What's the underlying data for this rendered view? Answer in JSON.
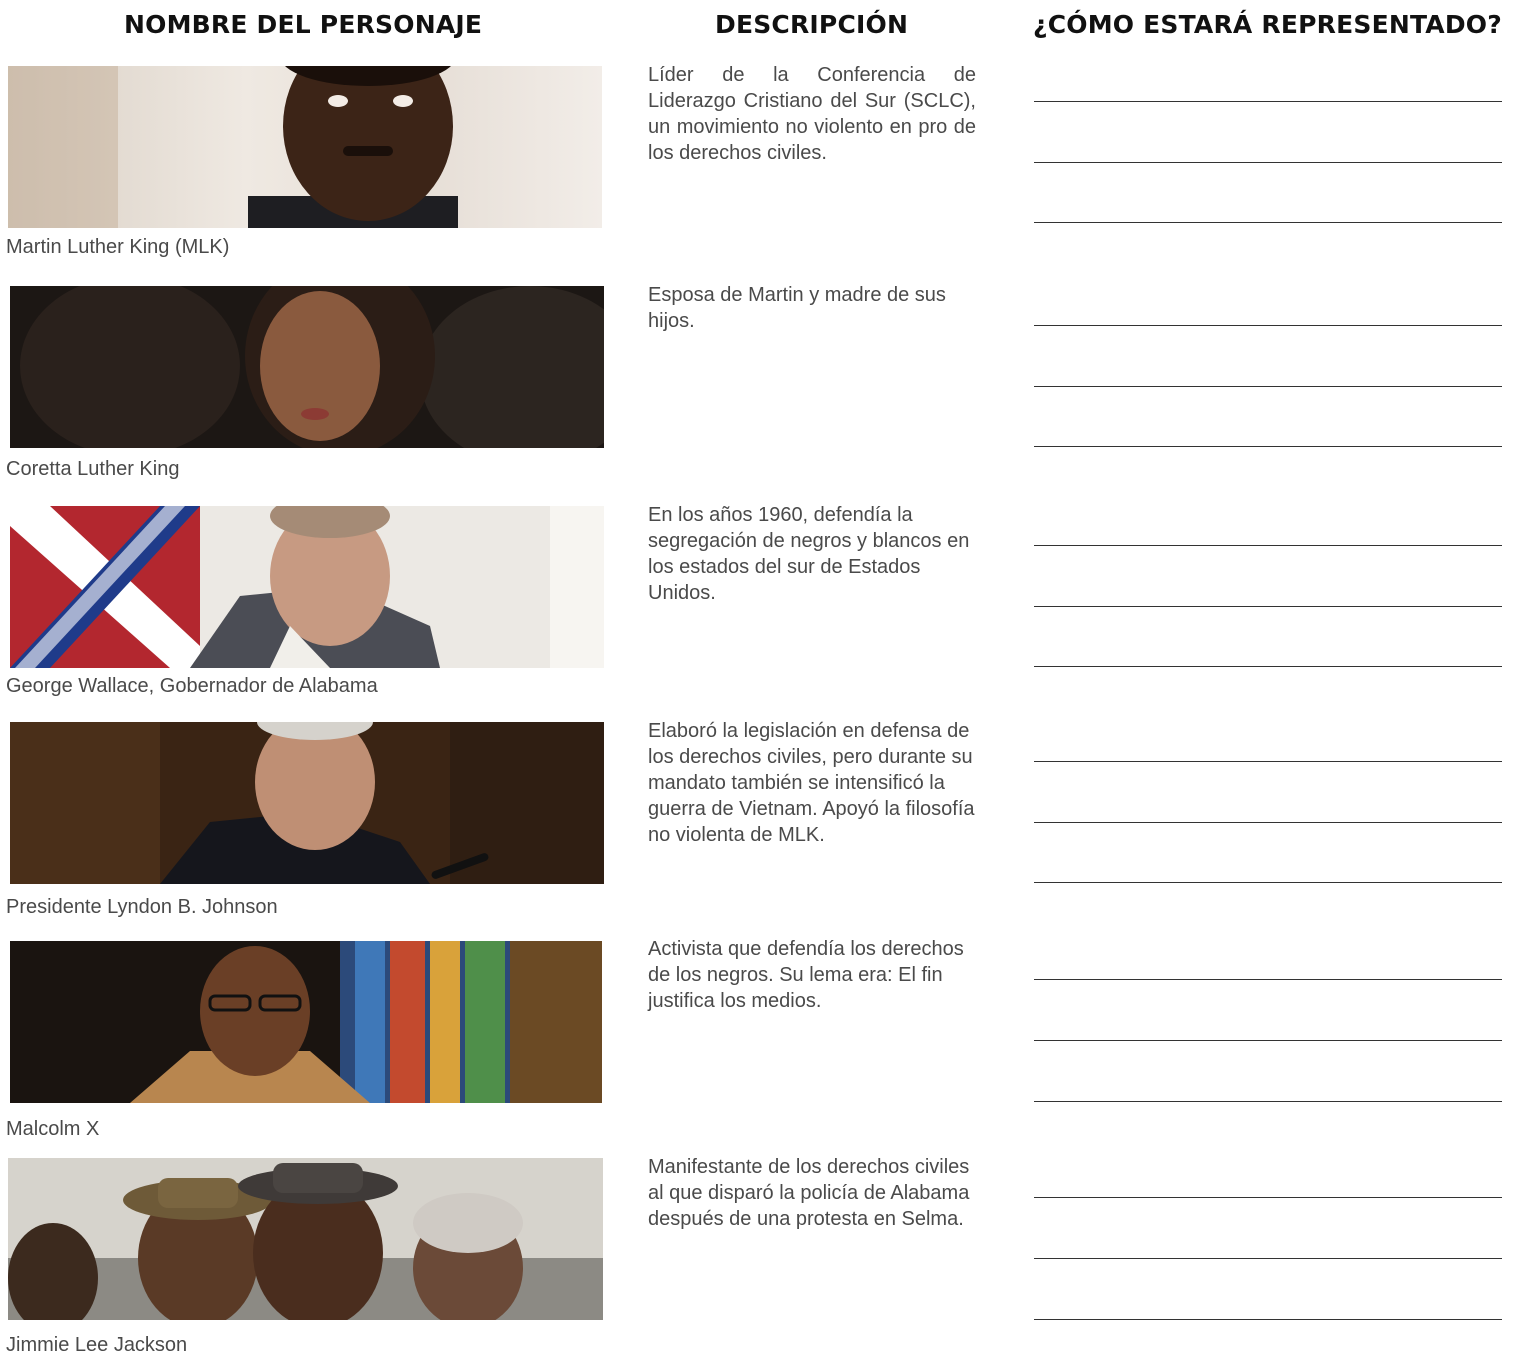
{
  "headers": {
    "name": "NOMBRE DEL PERSONAJE",
    "description": "DESCRIPCIÓN",
    "representation": "¿CÓMO ESTARÁ REPRESENTADO?"
  },
  "characters": [
    {
      "name": "Martin Luther King (MLK)",
      "description": "Líder de la Conferencia de Liderazgo Cristiano del Sur (SCLC), un movimiento no violento en pro de los derechos civiles."
    },
    {
      "name": "Coretta Luther King",
      "description": "Esposa de Martin y madre de sus hijos."
    },
    {
      "name": "George Wallace, Gobernador de Alabama",
      "description": "En los años 1960, defendía la segregación de negros y blancos en los estados del sur de Estados Unidos."
    },
    {
      "name": "Presidente Lyndon B. Johnson",
      "description": "Elaboró la legislación en defensa de los derechos civiles, pero durante su mandato también se intensificó la guerra de Vietnam. Apoyó la filosofía no violenta de MLK."
    },
    {
      "name": "Malcolm X",
      "description": "Activista que defendía los derechos de los negros. Su lema era: El fin justifica los medios."
    },
    {
      "name": "Jimmie Lee Jackson",
      "description": "Manifestante de los derechos civiles al que disparó la policía de Alabama después de una protesta en Selma."
    }
  ]
}
